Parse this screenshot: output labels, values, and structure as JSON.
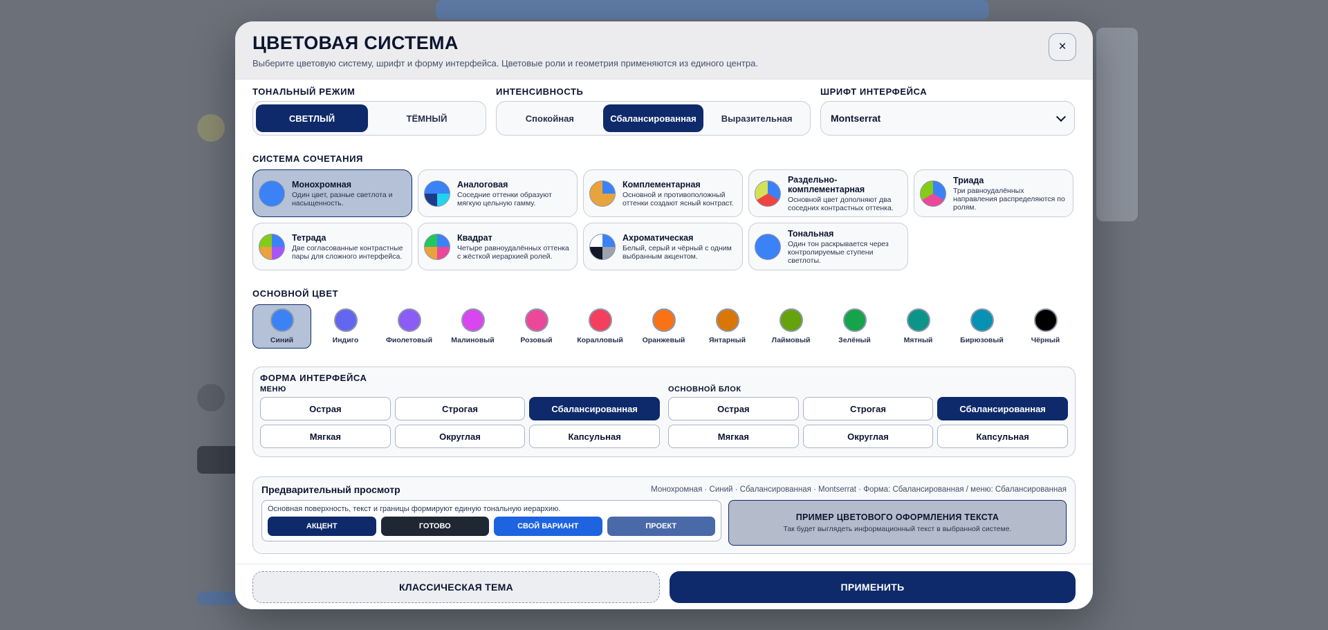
{
  "dialog": {
    "title": "ЦВЕТОВАЯ СИСТЕМА",
    "subtitle": "Выберите цветовую систему, шрифт и форму интерфейса. Цветовые роли и геометрия применяются из единого центра.",
    "close_label": "×"
  },
  "tone": {
    "label": "ТОНАЛЬНЫЙ РЕЖИМ",
    "options": [
      "СВЕТЛЫЙ",
      "ТЁМНЫЙ"
    ],
    "selected": "СВЕТЛЫЙ"
  },
  "intensity": {
    "label": "ИНТЕНСИВНОСТЬ",
    "options": [
      "Спокойная",
      "Сбалансированная",
      "Выразительная"
    ],
    "selected": "Сбалансированная"
  },
  "font": {
    "label": "ШРИФТ ИНТЕРФЕЙСА",
    "value": "Montserrat"
  },
  "combination": {
    "label": "СИСТЕМА СОЧЕТАНИЯ",
    "selected": "Монохромная",
    "items": [
      {
        "title": "Монохромная",
        "desc": "Один цвет, разные светлота и насыщенность.",
        "icon": "mono-swatch"
      },
      {
        "title": "Аналоговая",
        "desc": "Соседние оттенки образуют мягкую цельную гамму.",
        "icon": "analog-swatch"
      },
      {
        "title": "Комплементарная",
        "desc": "Основной и противоположный оттенки создают ясный контраст.",
        "icon": "complementary-swatch"
      },
      {
        "title": "Раздельно-комплементарная",
        "desc": "Основной цвет дополняют два соседних контрастных оттенка.",
        "icon": "split-complementary-swatch"
      },
      {
        "title": "Триада",
        "desc": "Три равноудалённых направления распределяются по ролям.",
        "icon": "triad-swatch"
      },
      {
        "title": "Тетрада",
        "desc": "Две согласованные контрастные пары для сложного интерфейса.",
        "icon": "tetrad-swatch"
      },
      {
        "title": "Квадрат",
        "desc": "Четыре равноудалённых оттенка с жёсткой иерархией ролей.",
        "icon": "square-swatch"
      },
      {
        "title": "Ахроматическая",
        "desc": "Белый, серый и чёрный с одним выбранным акцентом.",
        "icon": "achromatic-swatch"
      },
      {
        "title": "Тональная",
        "desc": "Один тон раскрывается через контролируемые ступени светлоты.",
        "icon": "tonal-swatch"
      }
    ]
  },
  "base_color": {
    "label": "ОСНОВНОЙ ЦВЕТ",
    "selected": "Синий",
    "items": [
      {
        "name": "Синий",
        "hex": "#3b82f6"
      },
      {
        "name": "Индиго",
        "hex": "#6366f1"
      },
      {
        "name": "Фиолетовый",
        "hex": "#8b5cf6"
      },
      {
        "name": "Малиновый",
        "hex": "#d946ef"
      },
      {
        "name": "Розовый",
        "hex": "#ec4899"
      },
      {
        "name": "Коралловый",
        "hex": "#f43f5e"
      },
      {
        "name": "Оранжевый",
        "hex": "#f97316"
      },
      {
        "name": "Янтарный",
        "hex": "#d97706"
      },
      {
        "name": "Лаймовый",
        "hex": "#65a30d"
      },
      {
        "name": "Зелёный",
        "hex": "#16a34a"
      },
      {
        "name": "Мятный",
        "hex": "#0d9488"
      },
      {
        "name": "Бирюзовый",
        "hex": "#0891b2"
      },
      {
        "name": "Чёрный",
        "hex": "#000000"
      }
    ]
  },
  "shape": {
    "label": "ФОРМА ИНТЕРФЕЙСА",
    "menu": {
      "label": "МЕНЮ",
      "options": [
        "Острая",
        "Строгая",
        "Сбалансированная",
        "Мягкая",
        "Округлая",
        "Капсульная"
      ],
      "selected": "Сбалансированная"
    },
    "main_block": {
      "label": "ОСНОВНОЙ БЛОК",
      "options": [
        "Острая",
        "Строгая",
        "Сбалансированная",
        "Мягкая",
        "Округлая",
        "Капсульная"
      ],
      "selected": "Сбалансированная"
    }
  },
  "preview": {
    "title": "Предварительный просмотр",
    "meta": "Монохромная · Синий · Сбалансированная · Montserrat · Форма: Сбалансированная / меню: Сбалансированная",
    "surface_text": "Основная поверхность, текст и границы формируют единую тональную иерархию.",
    "chips": [
      {
        "label": "АКЦЕНТ",
        "color": "#0e2a6b"
      },
      {
        "label": "ГОТОВО",
        "color": "#1f2733"
      },
      {
        "label": "СВОЙ ВАРИАНТ",
        "color": "#1e63e0"
      },
      {
        "label": "ПРОЕКТ",
        "color": "#4a69a8"
      }
    ],
    "sample_title": "ПРИМЕР ЦВЕТОВОГО ОФОРМЛЕНИЯ ТЕКСТА",
    "sample_desc": "Так будет выглядеть информационный текст в выбранной системе."
  },
  "footer": {
    "classic_label": "КЛАССИЧЕСКАЯ ТЕМА",
    "apply_label": "ПРИМЕНИТЬ"
  },
  "colors": {
    "accent": "#0e2a6b",
    "selected_bg": "#b4c1d6"
  }
}
